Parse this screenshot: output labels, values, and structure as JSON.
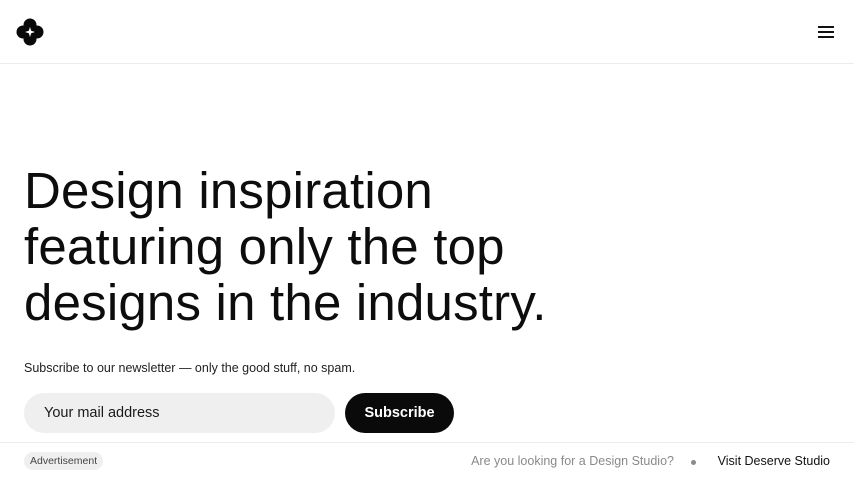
{
  "header": {
    "logo_icon": "clover-logo-icon",
    "menu_icon": "hamburger-menu-icon"
  },
  "hero": {
    "lines": [
      "Design inspiration",
      "featuring only the top",
      "designs in the industry."
    ]
  },
  "newsletter": {
    "text": "Subscribe to our newsletter — only the good stuff, no spam.",
    "email_placeholder": "Your mail address",
    "email_value": "",
    "button_label": "Subscribe"
  },
  "ad_bar": {
    "badge": "Advertisement",
    "question": "Are you looking for a Design Studio?",
    "link_label": "Visit Deserve Studio"
  },
  "colors": {
    "text": "#0d0d0d",
    "button_bg": "#0a0a0a",
    "input_bg": "#efefef",
    "muted": "#8a8a8a"
  }
}
